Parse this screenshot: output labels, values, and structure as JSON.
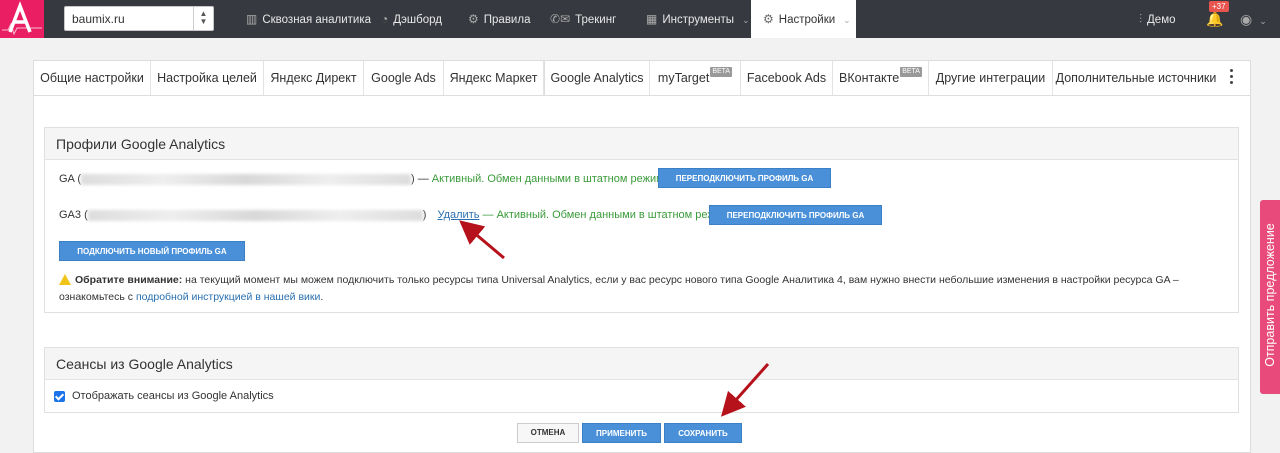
{
  "topbar": {
    "site": "baumix.ru",
    "nav": [
      {
        "label": "Сквозная аналитика",
        "icon": "bar-chart-icon"
      },
      {
        "label": "Дэшборд",
        "icon": "gauge-icon"
      },
      {
        "label": "Правила",
        "icon": "gears-icon"
      },
      {
        "label": "Трекинг",
        "icon": "phone-mail-icon"
      },
      {
        "label": "Инструменты",
        "icon": "grid-icon"
      },
      {
        "label": "Настройки",
        "icon": "gear-icon"
      }
    ],
    "user": "Демо",
    "notifications_count": "+37"
  },
  "tabs": [
    {
      "label": "Общие настройки",
      "beta": ""
    },
    {
      "label": "Настройка целей",
      "beta": ""
    },
    {
      "label": "Яндекс Директ",
      "beta": ""
    },
    {
      "label": "Google Ads",
      "beta": ""
    },
    {
      "label": "Яндекс Маркет",
      "beta": ""
    },
    {
      "label": "Google Analytics",
      "beta": ""
    },
    {
      "label": "myTarget",
      "beta": "BETA"
    },
    {
      "label": "Facebook Ads",
      "beta": ""
    },
    {
      "label": "ВКонтакте",
      "beta": "BETA"
    },
    {
      "label": "Другие интеграции",
      "beta": ""
    },
    {
      "label": "Дополнительные источники",
      "beta": ""
    }
  ],
  "ga_section": {
    "title": "Профили Google Analytics",
    "profile1_prefix": "GA (",
    "profile1_suffix": ") — ",
    "profile1_status": "Активный. Обмен данными в штатном режиме",
    "profile1_button": "ПЕРЕПОДКЛЮЧИТЬ ПРОФИЛЬ GA",
    "profile2_prefix": "GA3 (",
    "profile2_suffix": ")",
    "profile2_delete": "Удалить",
    "profile2_status": " — Активный. Обмен данными в штатном режиме",
    "profile2_button": "ПЕРЕПОДКЛЮЧИТЬ ПРОФИЛЬ GA",
    "connect_button": "ПОДКЛЮЧИТЬ НОВЫЙ ПРОФИЛЬ GA",
    "note_bold": "Обратите внимание:",
    "note_text": " на текущий момент мы можем подключить только ресурсы типа Universal Analytics, если у вас ресурс нового типа Google Аналитика 4, вам нужно внести небольшие изменения в настройки ресурса GA – ознакомьтесь с ",
    "note_link": "подробной инструкцией в нашей вики",
    "note_end": "."
  },
  "sessions_section": {
    "title": "Сеансы из Google Analytics",
    "checkbox_label": "Отображать сеансы из Google Analytics",
    "checked": true
  },
  "actions": {
    "cancel": "ОТМЕНА",
    "apply": "ПРИМЕНИТЬ",
    "save": "СОХРАНИТЬ"
  },
  "feedback": "Отправить предложение",
  "colors": {
    "brand": "#e91e63",
    "topbar": "#36393f",
    "button": "#4a90d9",
    "status_green": "#3a9b3a",
    "annotation_arrow": "#b5121b"
  }
}
